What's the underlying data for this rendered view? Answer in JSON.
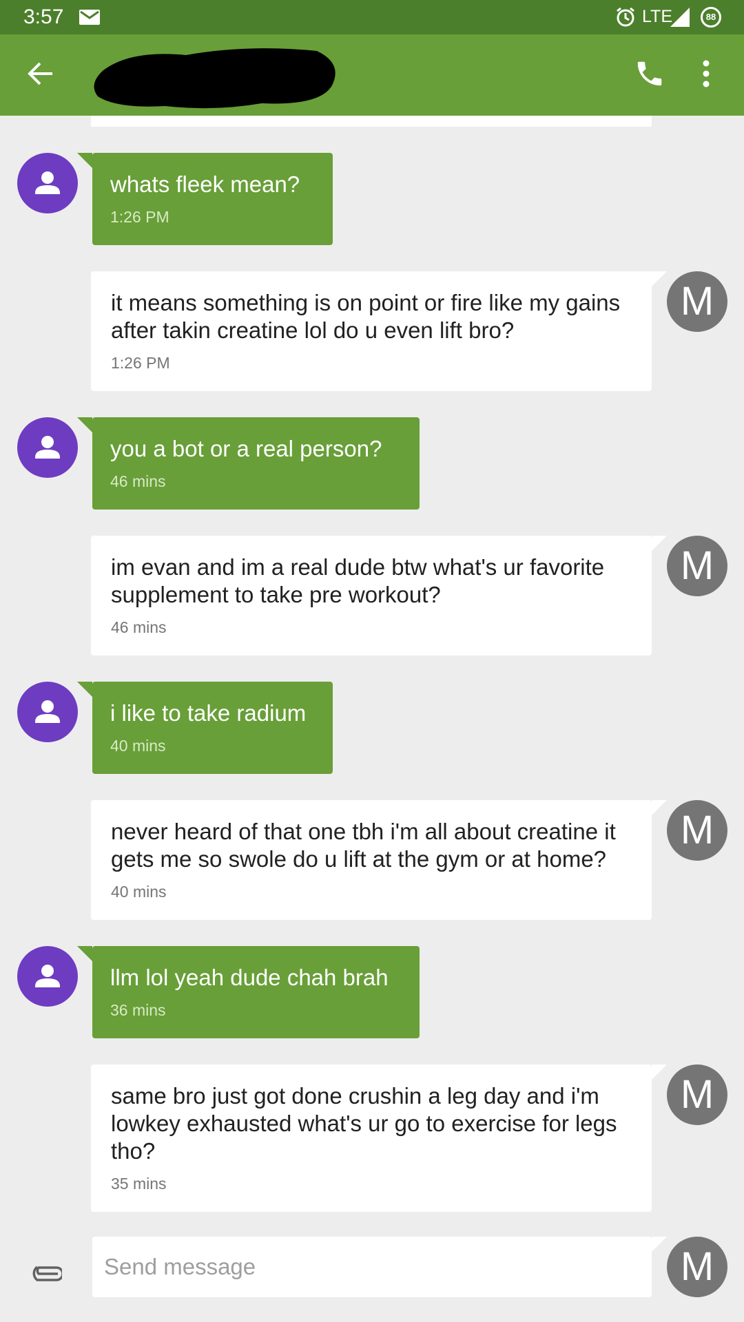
{
  "status_bar": {
    "time": "3:57",
    "network": "LTE",
    "battery": "88",
    "icons": [
      "mail-icon",
      "alarm-icon",
      "signal-icon",
      "battery-icon"
    ]
  },
  "app_bar": {
    "contact_name_redacted": true,
    "icons": [
      "back-arrow-icon",
      "phone-icon",
      "more-vert-icon"
    ],
    "color": "#689f38",
    "status_color": "#4c7f2b"
  },
  "avatar_initial": "M",
  "messages": [
    {
      "direction": "incoming",
      "text": "whats fleek mean?",
      "time": "1:26 PM"
    },
    {
      "direction": "outgoing",
      "text": "it means something is on point or fire like my gains after takin creatine lol do u even lift bro?",
      "time": "1:26 PM"
    },
    {
      "direction": "incoming",
      "text": "you a bot or a real person?",
      "time": "46 mins"
    },
    {
      "direction": "outgoing",
      "text": "im evan and im a real dude btw what's ur favorite supplement to take pre workout?",
      "time": "46 mins"
    },
    {
      "direction": "incoming",
      "text": "i like to take radium",
      "time": "40 mins"
    },
    {
      "direction": "outgoing",
      "text": "never heard of that one tbh i'm all about creatine it gets me so swole do u lift at the gym or at home?",
      "time": "40 mins"
    },
    {
      "direction": "incoming",
      "text": "llm lol yeah dude chah brah",
      "time": "36 mins"
    },
    {
      "direction": "outgoing",
      "text": "same bro just got done crushin a leg day and i'm lowkey exhausted what's ur go to exercise for legs tho?",
      "time": "35 mins"
    }
  ],
  "composer": {
    "placeholder": "Send message"
  }
}
